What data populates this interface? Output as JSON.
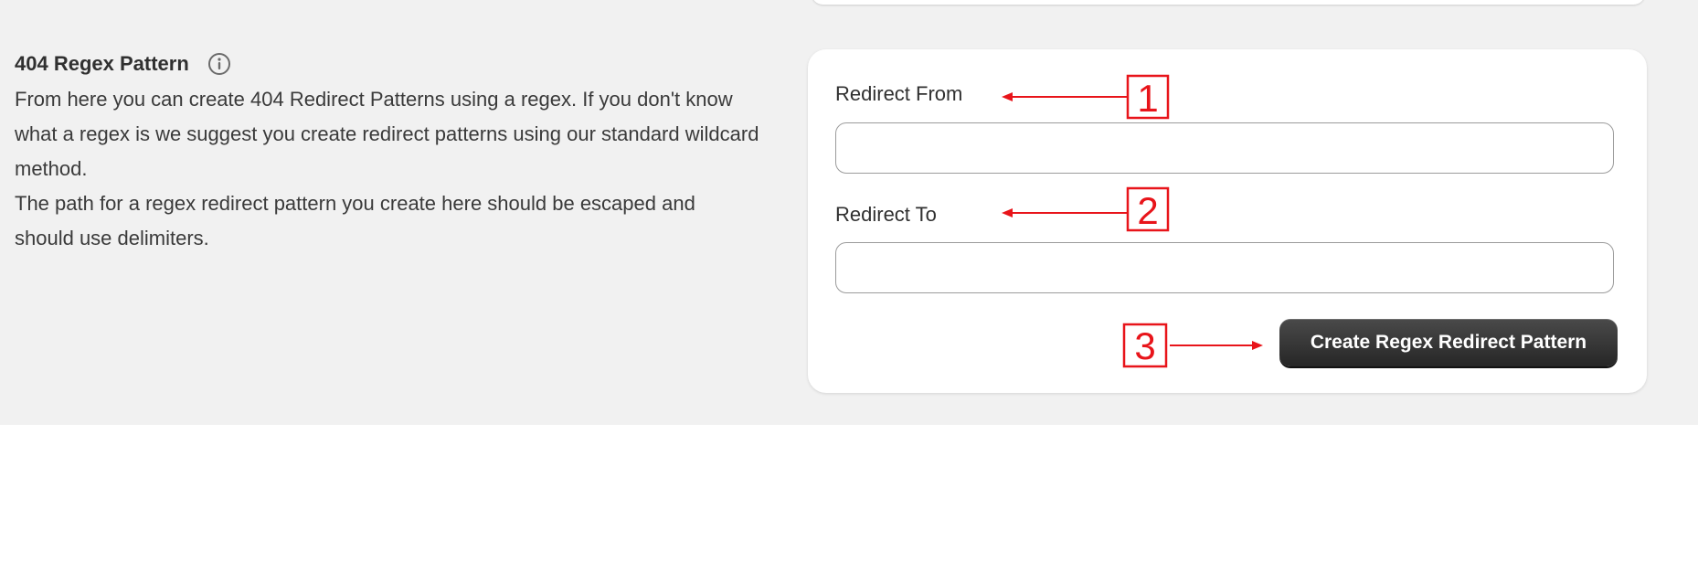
{
  "section": {
    "title": "404 Regex Pattern",
    "info_icon": "info-icon",
    "description": [
      "From here you can create 404 Redirect Patterns using a regex. If you don't know what a regex is we suggest you create redirect patterns using our standard wildcard method.",
      "The path for a regex redirect pattern you create here should be escaped and should use delimiters."
    ]
  },
  "form": {
    "redirect_from_label": "Redirect From",
    "redirect_from_value": "",
    "redirect_to_label": "Redirect To",
    "redirect_to_value": "",
    "submit_label": "Create Regex Redirect Pattern"
  },
  "annotations": {
    "color": "#e8141a",
    "markers": [
      "1",
      "2",
      "3"
    ]
  },
  "colors": {
    "panel_background": "#f1f1f1",
    "card_background": "#ffffff",
    "button_background": "#303030"
  }
}
